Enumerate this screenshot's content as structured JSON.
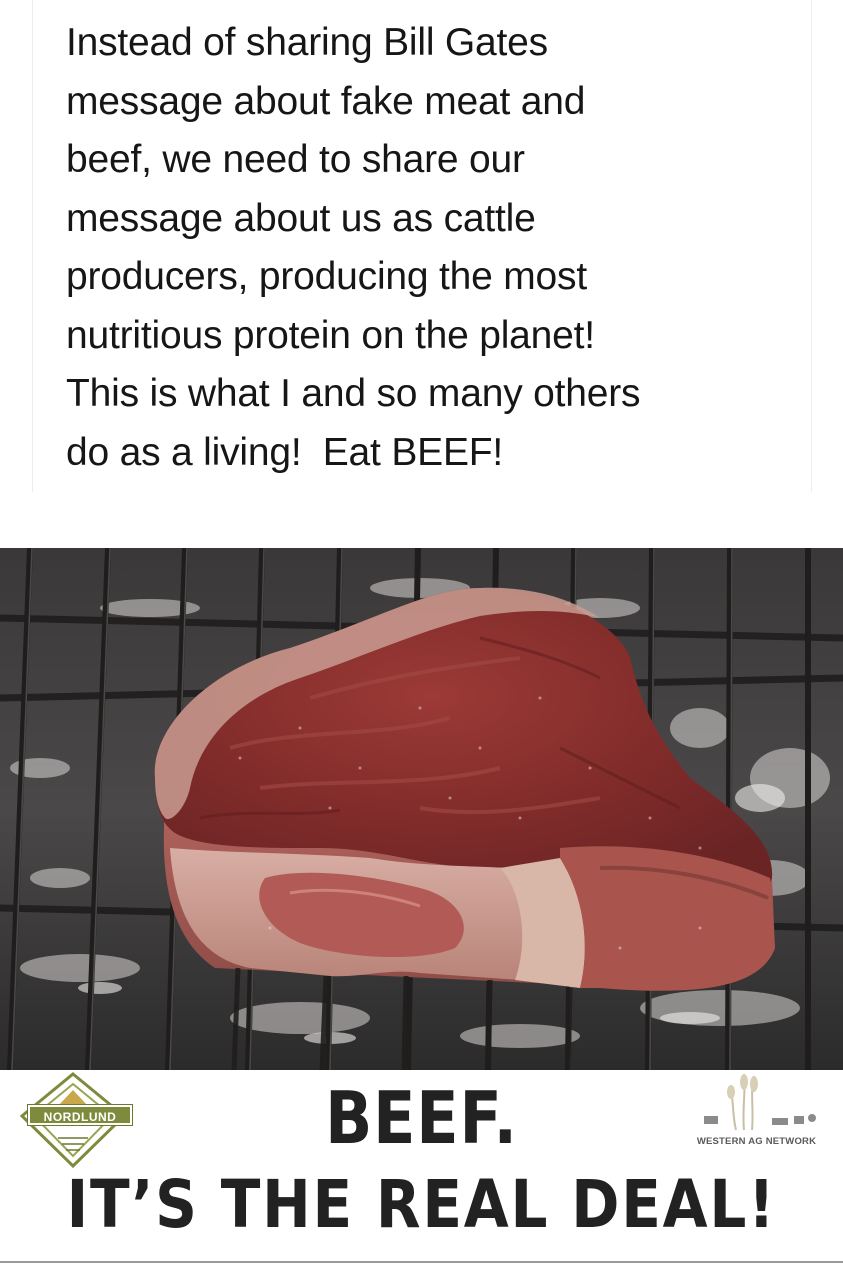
{
  "post": {
    "text": "Instead of sharing Bill Gates\nmessage about fake meat and\nbeef, we need to share our\nmessage about us as cattle\nproducers, producing the most\nnutritious protein on the planet!\nThis is what I and so many others\ndo as a living!  Eat BEEF!"
  },
  "photo": {
    "subject_icon": "steak-on-grill-photo"
  },
  "footer": {
    "headline_line1": "BEEF.",
    "headline_line2": "IT’S THE REAL DEAL!",
    "logo_left_name": "NORDLUND",
    "logo_right_name": "WESTERN AG NETWORK"
  },
  "colors": {
    "text": "#161616",
    "headline": "#222222",
    "nordlund_green": "#7e8a3c",
    "meat_red": "#8a2e2c",
    "fat_pink": "#c99c92"
  }
}
